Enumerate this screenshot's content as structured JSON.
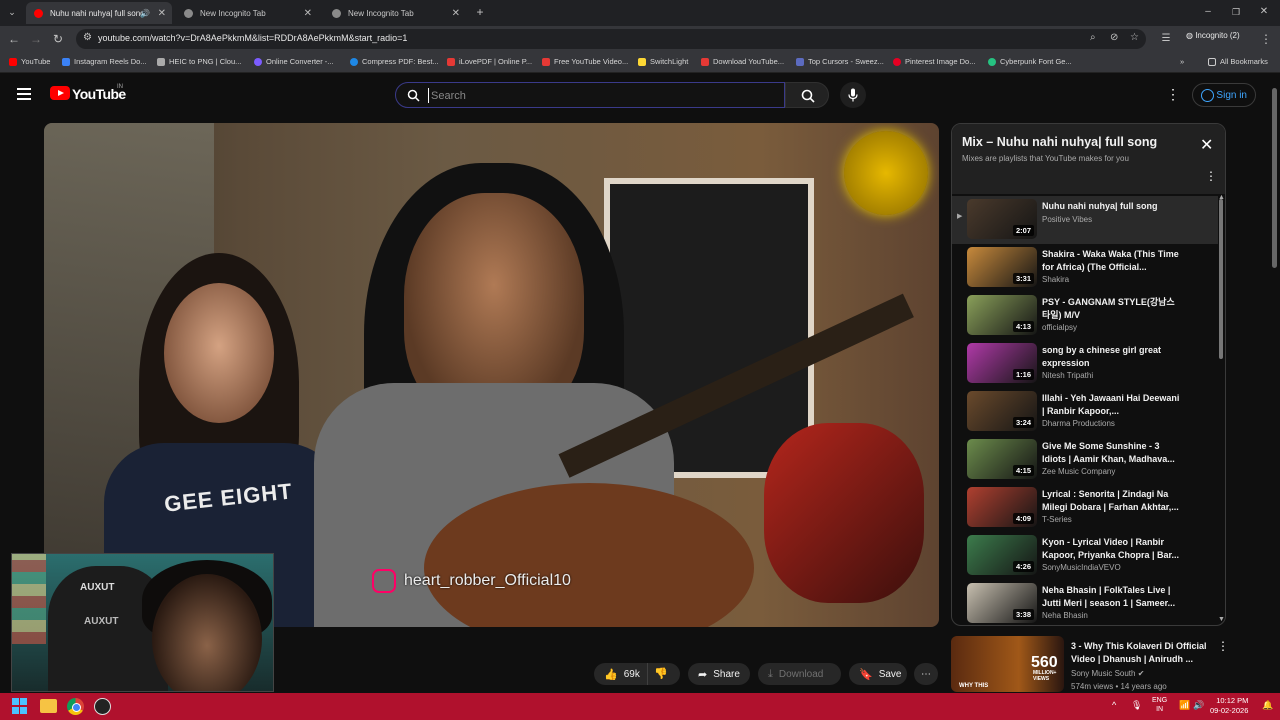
{
  "browser": {
    "tabs": [
      {
        "label": "Nuhu nahi nuhya| full song",
        "active": true
      },
      {
        "label": "New Incognito Tab",
        "active": false
      },
      {
        "label": "New Incognito Tab",
        "active": false
      }
    ],
    "new_tab": "+",
    "url": "youtube.com/watch?v=DrA8AePkkmM&list=RDDrA8AePkkmM&start_radio=1",
    "incognito_label": "Incognito (2)",
    "bookmarks": [
      {
        "label": "YouTube",
        "color": "#ff0000"
      },
      {
        "label": "Instagram Reels Do...",
        "color": "#3b82f6"
      },
      {
        "label": "HEIC to PNG | Clou...",
        "color": "#aaaaaa"
      },
      {
        "label": "Online Converter -...",
        "color": "#7c5cff"
      },
      {
        "label": "Compress PDF: Best...",
        "color": "#1e88e5"
      },
      {
        "label": "iLovePDF | Online P...",
        "color": "#e53935"
      },
      {
        "label": "Free YouTube Video...",
        "color": "#e53935"
      },
      {
        "label": "SwitchLight",
        "color": "#fdd835"
      },
      {
        "label": "Download YouTube...",
        "color": "#e53935"
      },
      {
        "label": "Top Cursors - Sweez...",
        "color": "#5c6bc0"
      },
      {
        "label": "Pinterest Image Do...",
        "color": "#e60023"
      },
      {
        "label": "Cyberpunk Font Ge...",
        "color": "#26c281"
      }
    ],
    "all_bookmarks": "All Bookmarks"
  },
  "youtube": {
    "logo_text": "YouTube",
    "country": "IN",
    "search_placeholder": "Search",
    "signin_label": "Sign in"
  },
  "video": {
    "watermark": "heart_robber_Official10",
    "shirt_text": "GEE EIGHT"
  },
  "webcam": {
    "logo_text": "AUXUT"
  },
  "actions": {
    "like_count": "69k",
    "share": "Share",
    "download": "Download",
    "save": "Save"
  },
  "playlist": {
    "title": "Mix – Nuhu nahi nuhya| full song",
    "subtitle": "Mixes are playlists that YouTube makes for you",
    "items": [
      {
        "title": "Nuhu nahi nuhya| full song",
        "channel": "Positive Vibes",
        "duration": "2:07",
        "active": true,
        "thumb": "#4a3a2c"
      },
      {
        "title": "Shakira - Waka Waka (This Time for Africa) (The Official...",
        "channel": "Shakira",
        "duration": "3:31",
        "active": false,
        "thumb": "#c88a3c"
      },
      {
        "title": "PSY - GANGNAM STYLE(강남스타일) M/V",
        "channel": "officialpsy",
        "duration": "4:13",
        "active": false,
        "thumb": "#8aa05a"
      },
      {
        "title": "song by a chinese girl great expression",
        "channel": "Nitesh Tripathi",
        "duration": "1:16",
        "active": false,
        "thumb": "#b03aa8"
      },
      {
        "title": "Illahi - Yeh Jawaani Hai Deewani | Ranbir Kapoor,...",
        "channel": "Dharma Productions",
        "duration": "3:24",
        "active": false,
        "thumb": "#6a4a2c"
      },
      {
        "title": "Give Me Some Sunshine - 3 Idiots | Aamir Khan, Madhava...",
        "channel": "Zee Music Company",
        "duration": "4:15",
        "active": false,
        "thumb": "#6c8c4c"
      },
      {
        "title": "Lyrical : Senorita | Zindagi Na Milegi Dobara | Farhan Akhtar,...",
        "channel": "T-Series",
        "duration": "4:09",
        "active": false,
        "thumb": "#b04030"
      },
      {
        "title": "Kyon - Lyrical Video | Ranbir Kapoor, Priyanka Chopra | Bar...",
        "channel": "SonyMusicIndiaVEVO",
        "duration": "4:26",
        "active": false,
        "thumb": "#3c7c4c"
      },
      {
        "title": "Neha Bhasin | FolkTales Live | Jutti Meri | season 1 | Sameer...",
        "channel": "Neha Bhasin",
        "duration": "3:38",
        "active": false,
        "thumb": "#c8c0b0"
      }
    ]
  },
  "recommendation": {
    "title": "3 - Why This Kolaveri Di Official Video | Dhanush | Anirudh ...",
    "channel": "Sony Music South ✔",
    "meta": "574m views • 14 years ago",
    "thumb_big": "560",
    "thumb_small": "MILLION+ VIEWS",
    "thumb_caption": "WHY THIS"
  },
  "taskbar": {
    "lang": "ENG",
    "region": "IN",
    "time": "10:12 PM",
    "date": "09-02-2026"
  }
}
